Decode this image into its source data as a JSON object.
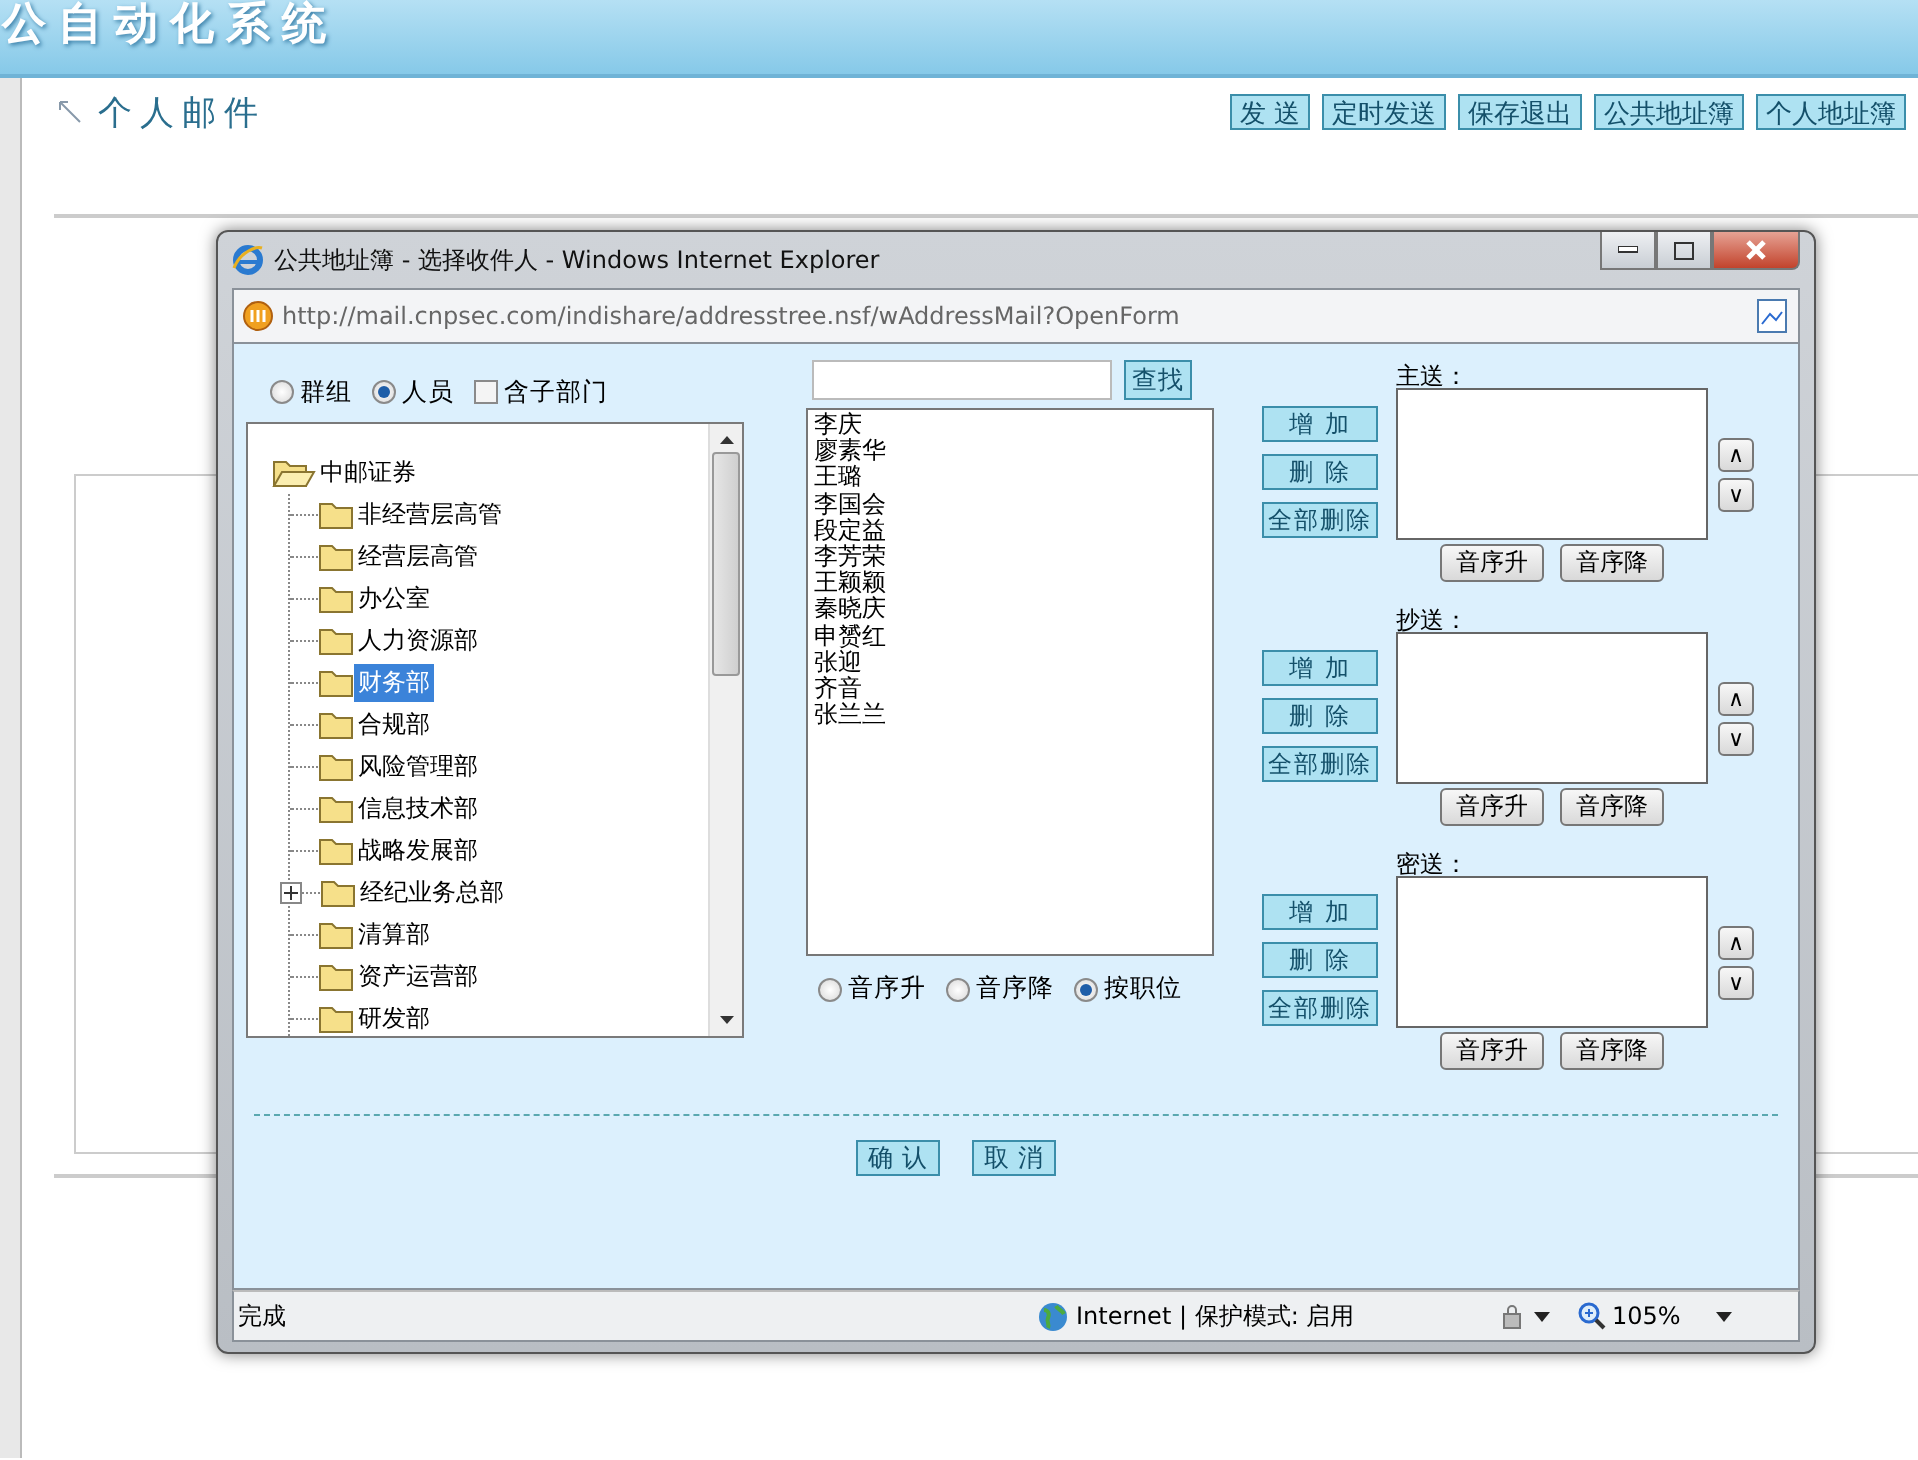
{
  "app": {
    "title": "公自动化系统"
  },
  "page": {
    "heading": "个人邮件",
    "actions": [
      "发 送",
      "定时发送",
      "保存退出",
      "公共地址簿",
      "个人地址簿"
    ]
  },
  "dialog": {
    "title": "公共地址簿 - 选择收件人 - Windows Internet Explorer",
    "url": "http://mail.cnpsec.com/indishare/addresstree.nsf/wAddressMail?OpenForm",
    "scope_options": [
      {
        "label": "群组",
        "selected": false
      },
      {
        "label": "人员",
        "selected": true
      }
    ],
    "include_subdepts": {
      "label": "含子部门",
      "checked": false
    },
    "tree": {
      "label": "中邮证券",
      "expanded": true,
      "children": [
        {
          "label": "非经营层高管",
          "selected": false,
          "expandable": false
        },
        {
          "label": "经营层高管",
          "selected": false,
          "expandable": false
        },
        {
          "label": "办公室",
          "selected": false,
          "expandable": false
        },
        {
          "label": "人力资源部",
          "selected": false,
          "expandable": false
        },
        {
          "label": "财务部",
          "selected": true,
          "expandable": false
        },
        {
          "label": "合规部",
          "selected": false,
          "expandable": false
        },
        {
          "label": "风险管理部",
          "selected": false,
          "expandable": false
        },
        {
          "label": "信息技术部",
          "selected": false,
          "expandable": false
        },
        {
          "label": "战略发展部",
          "selected": false,
          "expandable": false
        },
        {
          "label": "经纪业务总部",
          "selected": false,
          "expandable": true
        },
        {
          "label": "清算部",
          "selected": false,
          "expandable": false
        },
        {
          "label": "资产运营部",
          "selected": false,
          "expandable": false
        },
        {
          "label": "研发部",
          "selected": false,
          "expandable": false
        }
      ]
    },
    "search": {
      "button": "查找"
    },
    "people": [
      "李庆",
      "廖素华",
      "王璐",
      "李国会",
      "段定益",
      "李芳荣",
      "王颖颖",
      "秦晓庆",
      "申赟红",
      "张迎",
      "齐音",
      "张兰兰"
    ],
    "sort_options": [
      {
        "label": "音序升",
        "selected": false
      },
      {
        "label": "音序降",
        "selected": false
      },
      {
        "label": "按职位",
        "selected": true
      }
    ],
    "recipient_groups": [
      {
        "label": "主送：",
        "add": "增 加",
        "remove": "删 除",
        "remove_all": "全部删除",
        "sort_asc": "音序升",
        "sort_desc": "音序降",
        "up": "∧",
        "down": "∨"
      },
      {
        "label": "抄送：",
        "add": "增 加",
        "remove": "删 除",
        "remove_all": "全部删除",
        "sort_asc": "音序升",
        "sort_desc": "音序降",
        "up": "∧",
        "down": "∨"
      },
      {
        "label": "密送：",
        "add": "增 加",
        "remove": "删 除",
        "remove_all": "全部删除",
        "sort_asc": "音序升",
        "sort_desc": "音序降",
        "up": "∧",
        "down": "∨"
      }
    ],
    "confirm": "确 认",
    "cancel": "取 消",
    "status": {
      "text": "完成",
      "zone": "Internet | 保护模式: 启用",
      "zoom": "105%"
    }
  }
}
